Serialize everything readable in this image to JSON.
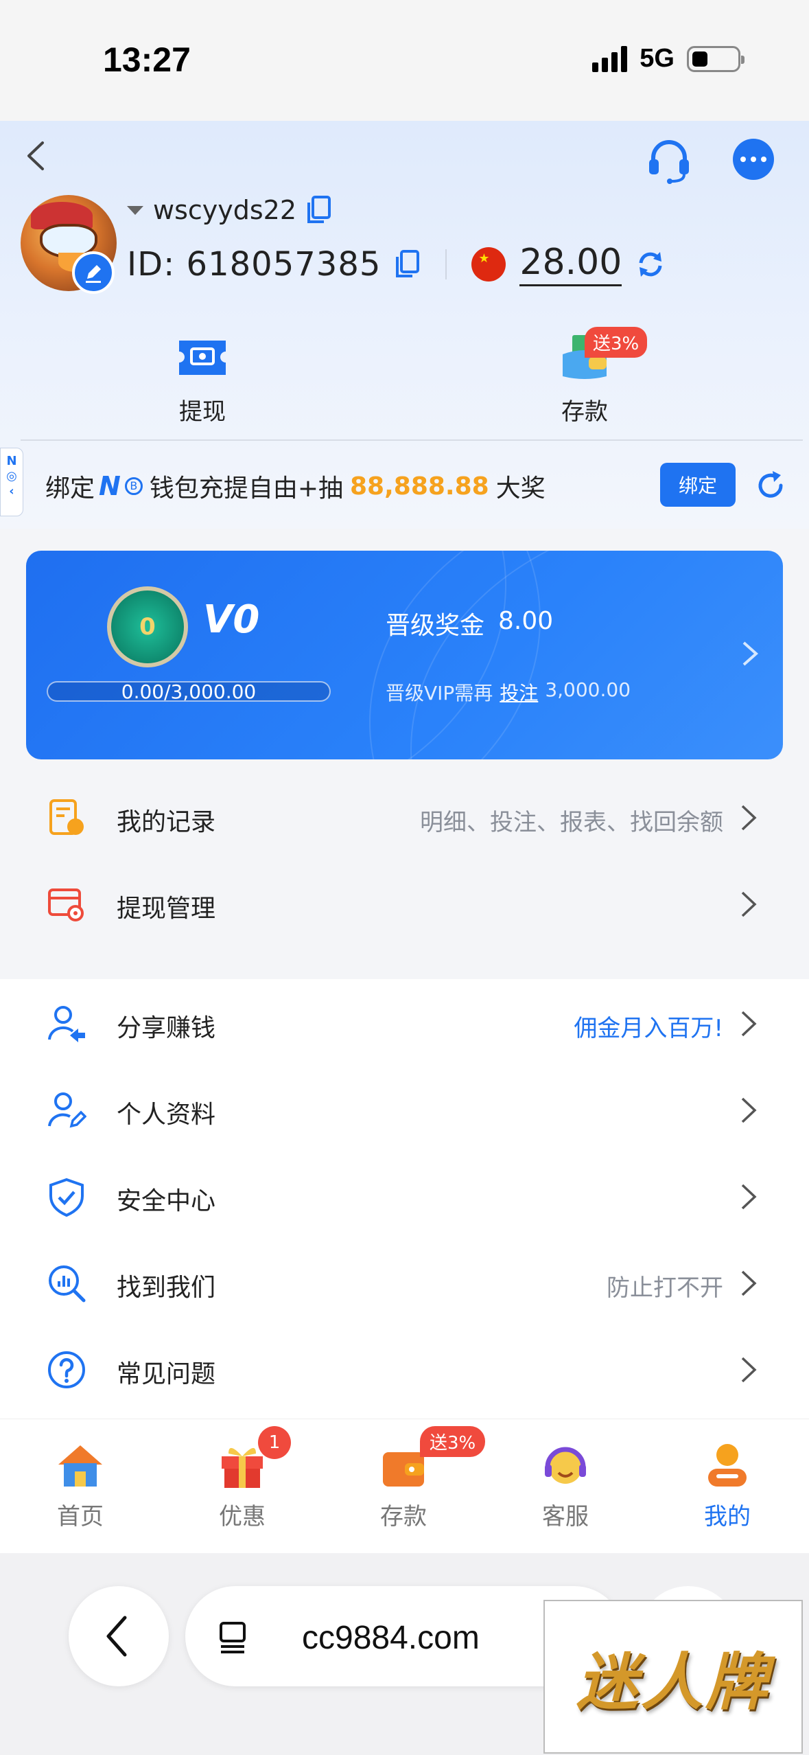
{
  "status_bar": {
    "time": "13:27",
    "network": "5G"
  },
  "header": {
    "username": "wscyyds22",
    "id_text": "ID: 618057385",
    "balance": "28.00",
    "quick_actions": [
      {
        "label": "提现",
        "icon": "withdraw-icon"
      },
      {
        "label": "存款",
        "icon": "deposit-wallet-icon",
        "badge": "送3%"
      }
    ]
  },
  "bind_bar": {
    "side_tab": "N",
    "prefix": "绑定",
    "brand": "N",
    "brand_coin": "B",
    "middle": "钱包充提自由+抽",
    "prize": "88,888.88",
    "suffix": "大奖",
    "button": "绑定"
  },
  "vip": {
    "medal_number": "0",
    "level": "V0",
    "progress_text": "0.00/3,000.00",
    "progress_ratio": 0,
    "bonus_label": "晋级奖金",
    "bonus_value": "8.00",
    "need_label": "晋级VIP需再",
    "need_link": "投注",
    "need_value": "3,000.00"
  },
  "menu_group1": [
    {
      "label": "我的记录",
      "extra": "明细、投注、报表、找回余额",
      "icon": "records-icon"
    },
    {
      "label": "提现管理",
      "extra": "",
      "icon": "withdraw-settings-icon"
    }
  ],
  "menu_group2": [
    {
      "label": "分享赚钱",
      "extra": "佣金月入百万!",
      "icon": "share-earn-icon"
    },
    {
      "label": "个人资料",
      "extra": "",
      "icon": "profile-edit-icon"
    },
    {
      "label": "安全中心",
      "extra": "",
      "icon": "shield-check-icon"
    },
    {
      "label": "找到我们",
      "extra": "防止打不开",
      "icon": "find-us-icon"
    },
    {
      "label": "常见问题",
      "extra": "",
      "icon": "question-icon"
    }
  ],
  "tabbar": {
    "tabs": [
      {
        "label": "首页",
        "icon": "home-icon",
        "active": false
      },
      {
        "label": "优惠",
        "icon": "gift-icon",
        "badge": "1",
        "active": false
      },
      {
        "label": "存款",
        "icon": "wallet-icon",
        "badge": "送3%",
        "active": false
      },
      {
        "label": "客服",
        "icon": "support-agent-icon",
        "active": false
      },
      {
        "label": "我的",
        "icon": "profile-icon",
        "active": true
      }
    ]
  },
  "browser": {
    "url": "cc9884.com"
  },
  "watermark": "迷人牌",
  "colors": {
    "primary": "#1f73f1",
    "accent": "#f6a21e",
    "badge": "#f04a3d"
  }
}
